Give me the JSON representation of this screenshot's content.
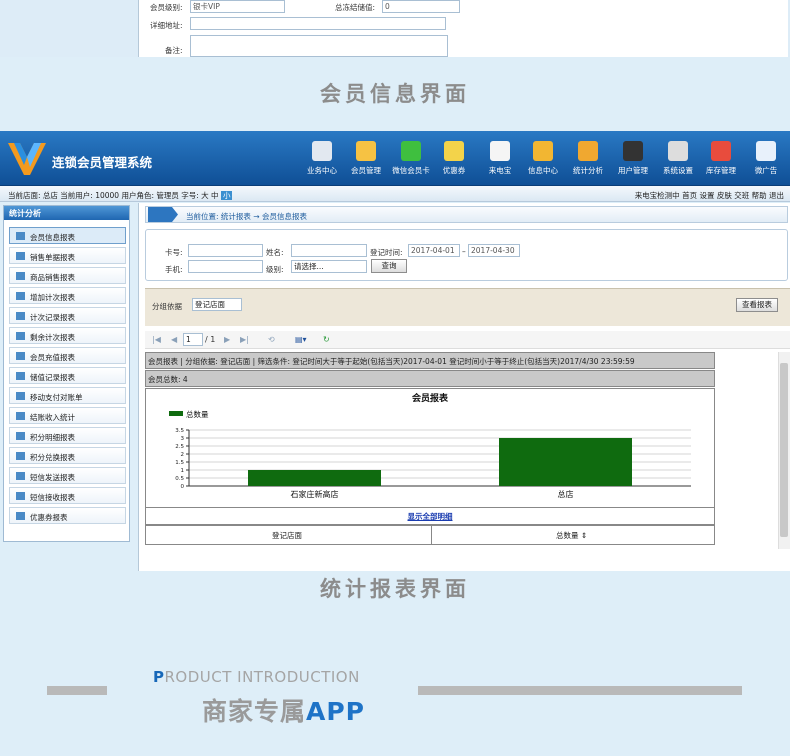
{
  "top_form": {
    "fields": [
      {
        "label": "会员级别:",
        "value": "银卡VIP"
      },
      {
        "label": "总冻结储值:",
        "value": "0"
      },
      {
        "label": "详细地址:",
        "value": ""
      },
      {
        "label": "备注:",
        "value": ""
      }
    ],
    "section_title": "会员信息界面"
  },
  "header": {
    "app_name": "连锁会员管理系统",
    "nav": [
      {
        "label": "业务中心",
        "icon": "business-icon",
        "color": "#e2e8f0"
      },
      {
        "label": "会员管理",
        "icon": "members-icon",
        "color": "#f6c243"
      },
      {
        "label": "微信会员卡",
        "icon": "wechat-icon",
        "color": "#3fbf3f"
      },
      {
        "label": "优惠券",
        "icon": "coupon-icon",
        "color": "#f3d34a"
      },
      {
        "label": "来电宝",
        "icon": "phone-icon",
        "color": "#f5f5f5"
      },
      {
        "label": "信息中心",
        "icon": "message-icon",
        "color": "#f2b632"
      },
      {
        "label": "统计分析",
        "icon": "chart-icon",
        "color": "#f0a830"
      },
      {
        "label": "用户管理",
        "icon": "user-icon",
        "color": "#333333"
      },
      {
        "label": "系统设置",
        "icon": "tools-icon",
        "color": "#dddddd"
      },
      {
        "label": "库存管理",
        "icon": "stock-icon",
        "color": "#e84c3d"
      },
      {
        "label": "微广告",
        "icon": "ads-icon",
        "color": "#e8f1fb"
      }
    ]
  },
  "infobar": {
    "left": "当前店面: 总店  当前用户: 10000  用户角色: 管理员  字号: 大 中",
    "font_small": "小",
    "right": "来电宝检测中  首页  设置  皮肤  交班  帮助  退出"
  },
  "sidebar": {
    "title": "统计分析",
    "items": [
      "会员信息报表",
      "销售单据报表",
      "商品销售报表",
      "增加计次报表",
      "计次记录报表",
      "剩余计次报表",
      "会员充值报表",
      "储值记录报表",
      "移动支付对账单",
      "结账收入统计",
      "积分明细报表",
      "积分兑换报表",
      "短信发送报表",
      "短信接收报表",
      "优惠券报表"
    ]
  },
  "breadcrumb": "当前位置: 统计报表 → 会员信息报表",
  "query": {
    "card_label": "卡号:",
    "name_label": "姓名:",
    "regtime_label": "登记时间:",
    "date_from": "2017-04-01",
    "date_sep": "–",
    "date_to": "2017-04-30",
    "phone_label": "手机:",
    "level_label": "级别:",
    "level_value": "请选择...",
    "search_button": "查询"
  },
  "group": {
    "label": "分组依据",
    "value": "登记店面",
    "view_button": "查看报表"
  },
  "pager": {
    "page": "1",
    "total": "/ 1"
  },
  "report": {
    "info": "会员报表 | 分组依据: 登记店面 | 筛选条件: 登记时间大于等于起始(包括当天)2017-04-01  登记时间小于等于终止(包括当天)2017/4/30 23:59:59",
    "total": "会员总数: 4",
    "show_all": "显示全部明细",
    "col1": "登记店面",
    "col2": "总数量"
  },
  "chart_data": {
    "type": "bar",
    "title": "会员报表",
    "legend": "总数量",
    "categories": [
      "石家庄新高店",
      "总店"
    ],
    "values": [
      1,
      3
    ],
    "ylim": [
      0,
      3.5
    ],
    "yticks": [
      "0",
      "0.5",
      "1",
      "1.5",
      "2",
      "2.5",
      "3",
      "3.5"
    ],
    "color": "#0f6b0f",
    "grid": true
  },
  "section_title_2": "统计报表界面",
  "bottom": {
    "intro_first": "P",
    "intro_rest": "RODUCT INTRODUCTION",
    "app_prefix": "商家专属",
    "app_suffix": "APP"
  }
}
